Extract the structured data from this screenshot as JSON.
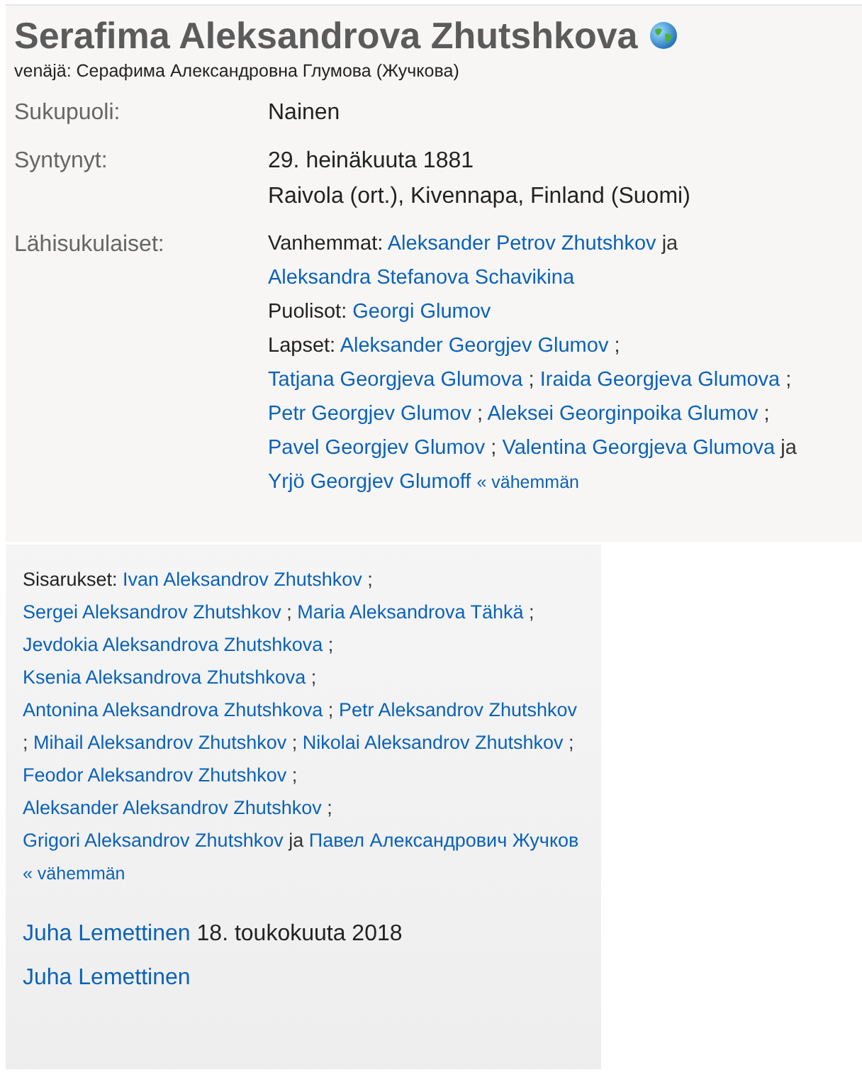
{
  "profile": {
    "name": "Serafima Aleksandrova Zhutshkova",
    "alt_name": "venäjä: Серафима Александровна Глумова (Жучкова)",
    "facts": [
      {
        "label": "Sukupuoli:",
        "lines": [
          "Nainen"
        ]
      },
      {
        "label": "Syntynyt:",
        "lines": [
          "29. heinäkuuta 1881",
          "Raivola (ort.), Kivennapa, Finland (Suomi)"
        ]
      }
    ],
    "relatives_label": "Lähisukulaiset:",
    "relative_groups": [
      {
        "label": "Vanhemmat:",
        "parts": [
          {
            "kind": "link",
            "text": "Aleksander Petrov Zhutshkov"
          },
          {
            "kind": "sep",
            "text": "ja"
          },
          {
            "kind": "link",
            "text": "Aleksandra Stefanova Schavikina"
          }
        ]
      },
      {
        "label": "Puolisot:",
        "parts": [
          {
            "kind": "link",
            "text": "Georgi Glumov"
          }
        ]
      },
      {
        "label": "Lapset:",
        "parts": [
          {
            "kind": "link",
            "text": "Aleksander Georgjev Glumov"
          },
          {
            "kind": "sep",
            "text": ";"
          },
          {
            "kind": "link",
            "text": "Tatjana Georgjeva Glumova"
          },
          {
            "kind": "sep",
            "text": ";"
          },
          {
            "kind": "link",
            "text": "Iraida Georgjeva Glumova"
          },
          {
            "kind": "sep",
            "text": ";"
          },
          {
            "kind": "link",
            "text": "Petr Georgjev Glumov"
          },
          {
            "kind": "sep",
            "text": ";"
          },
          {
            "kind": "link",
            "text": "Aleksei Georginpoika Glumov"
          },
          {
            "kind": "sep",
            "text": ";"
          },
          {
            "kind": "link",
            "text": "Pavel Georgjev Glumov"
          },
          {
            "kind": "sep",
            "text": ";"
          },
          {
            "kind": "link",
            "text": "Valentina Georgjeva Glumova"
          },
          {
            "kind": "sep",
            "text": "ja"
          },
          {
            "kind": "link",
            "text": "Yrjö Georgjev Glumoff"
          },
          {
            "kind": "less",
            "text": "« vähemmän"
          }
        ]
      }
    ]
  },
  "continuation": {
    "groups": [
      {
        "label": "Sisarukset:",
        "parts": [
          {
            "kind": "link",
            "text": "Ivan Aleksandrov Zhutshkov"
          },
          {
            "kind": "sep",
            "text": ";"
          },
          {
            "kind": "link",
            "text": "Sergei Aleksandrov Zhutshkov"
          },
          {
            "kind": "sep",
            "text": ";"
          },
          {
            "kind": "link",
            "text": "Maria Aleksandrova Tähkä"
          },
          {
            "kind": "sep",
            "text": ";"
          },
          {
            "kind": "link",
            "text": "Jevdokia Aleksandrova Zhutshkova"
          },
          {
            "kind": "sep",
            "text": ";"
          },
          {
            "kind": "link",
            "text": "Ksenia Aleksandrova Zhutshkova"
          },
          {
            "kind": "sep",
            "text": ";"
          },
          {
            "kind": "link",
            "text": "Antonina Aleksandrova Zhutshkova"
          },
          {
            "kind": "sep",
            "text": ";"
          },
          {
            "kind": "link",
            "text": "Petr Aleksandrov Zhutshkov"
          },
          {
            "kind": "sep",
            "text": ";"
          },
          {
            "kind": "link",
            "text": "Mihail Aleksandrov Zhutshkov"
          },
          {
            "kind": "sep",
            "text": ";"
          },
          {
            "kind": "link",
            "text": "Nikolai Aleksandrov Zhutshkov"
          },
          {
            "kind": "sep",
            "text": ";"
          },
          {
            "kind": "link",
            "text": "Feodor Aleksandrov Zhutshkov"
          },
          {
            "kind": "sep",
            "text": ";"
          },
          {
            "kind": "link",
            "text": "Aleksander Aleksandrov Zhutshkov"
          },
          {
            "kind": "sep",
            "text": ";"
          },
          {
            "kind": "link",
            "text": "Grigori Aleksandrov Zhutshkov"
          },
          {
            "kind": "sep",
            "text": "ja"
          },
          {
            "kind": "link",
            "text": "Павел Александрович Жучков"
          },
          {
            "kind": "less",
            "text": "« vähemmän"
          }
        ]
      }
    ],
    "manager": {
      "link": "Juha Lemettinen",
      "date": "18. toukokuuta 2018"
    },
    "curator": "Juha Lemettinen"
  }
}
